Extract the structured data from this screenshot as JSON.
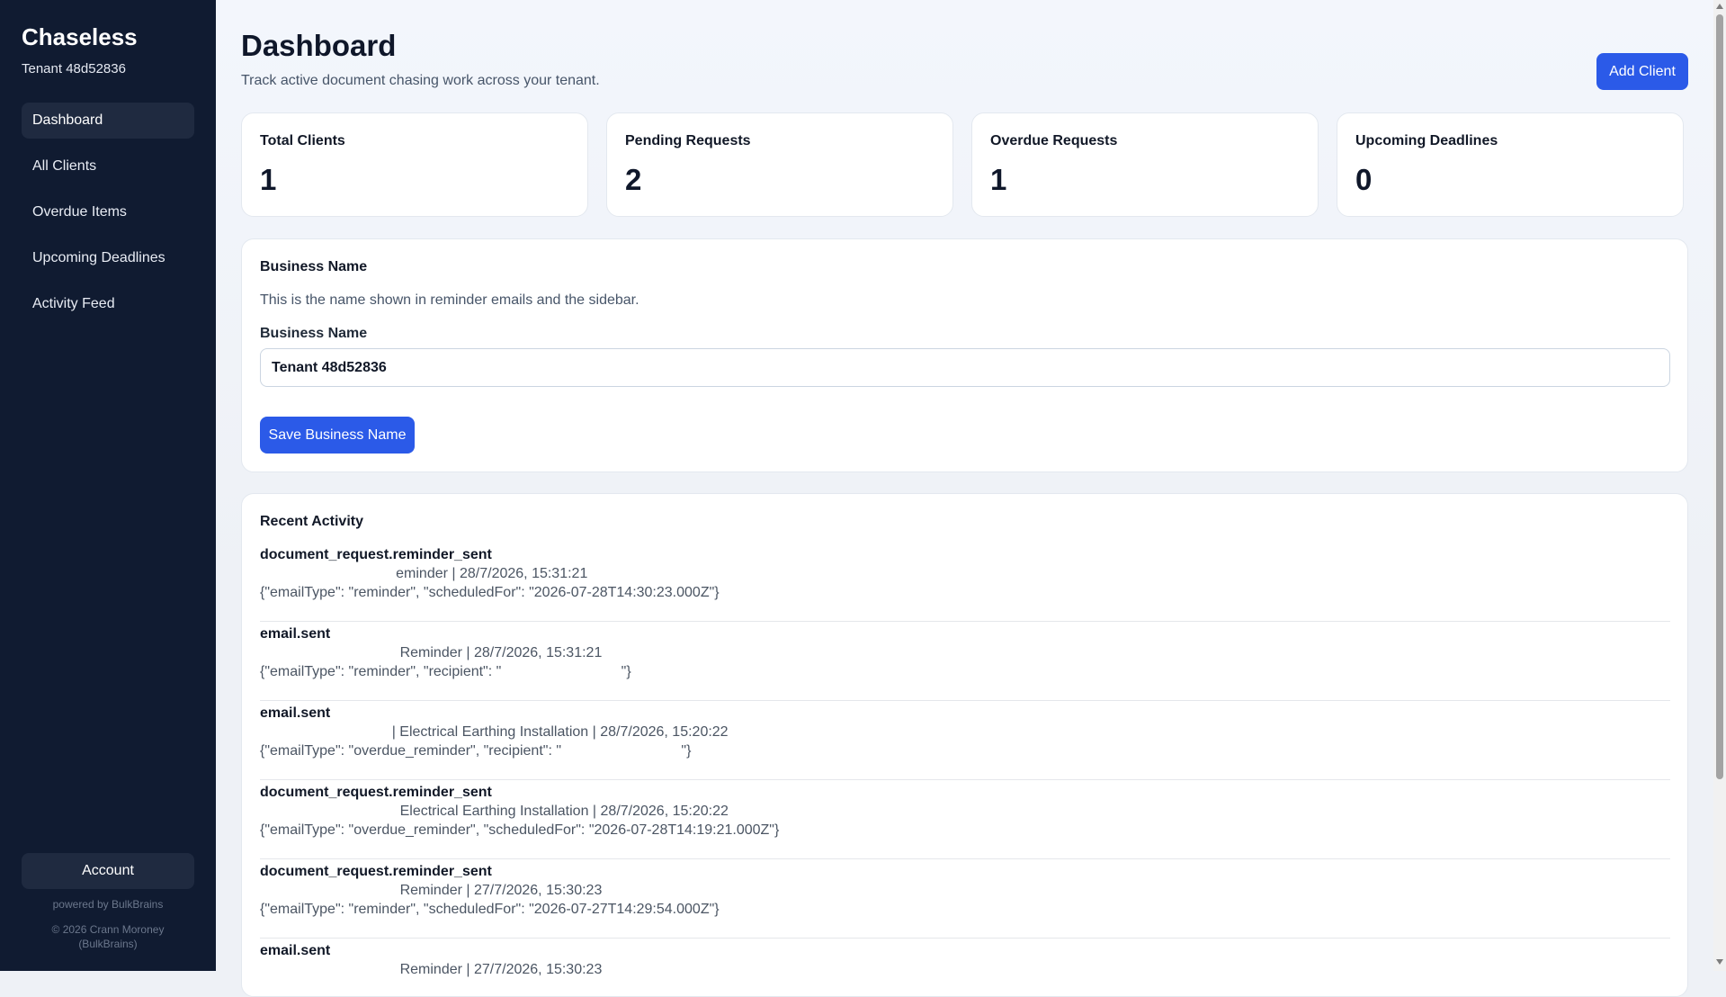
{
  "sidebar": {
    "brand": "Chaseless",
    "tenant": "Tenant 48d52836",
    "nav": [
      {
        "label": "Dashboard"
      },
      {
        "label": "All Clients"
      },
      {
        "label": "Overdue Items"
      },
      {
        "label": "Upcoming Deadlines"
      },
      {
        "label": "Activity Feed"
      }
    ],
    "active_nav": "Dashboard",
    "account_label": "Account",
    "powered_by": "powered by BulkBrains",
    "copyright_line1": "© 2026 Crann Moroney",
    "copyright_line2": "(BulkBrains)"
  },
  "header": {
    "title": "Dashboard",
    "subtitle": "Track active document chasing work across your tenant.",
    "add_client_label": "Add Client"
  },
  "stats": [
    {
      "label": "Total Clients",
      "value": "1"
    },
    {
      "label": "Pending Requests",
      "value": "2"
    },
    {
      "label": "Overdue Requests",
      "value": "1"
    },
    {
      "label": "Upcoming Deadlines",
      "value": "0"
    }
  ],
  "business": {
    "heading": "Business Name",
    "description": "This is the name shown in reminder emails and the sidebar.",
    "field_label": "Business Name",
    "field_value": "Tenant 48d52836",
    "save_label": "Save Business Name"
  },
  "activity": {
    "heading": "Recent Activity",
    "items": [
      {
        "title": "document_request.reminder_sent",
        "meta": "                                  eminder | 28/7/2026, 15:31:21",
        "detail": "{\"emailType\": \"reminder\", \"scheduledFor\": \"2026-07-28T14:30:23.000Z\"}"
      },
      {
        "title": "email.sent",
        "meta": "                                   Reminder | 28/7/2026, 15:31:21",
        "detail": "{\"emailType\": \"reminder\", \"recipient\": \"                              \"}"
      },
      {
        "title": "email.sent",
        "meta": "                                 | Electrical Earthing Installation | 28/7/2026, 15:20:22",
        "detail": "{\"emailType\": \"overdue_reminder\", \"recipient\": \"                              \"}"
      },
      {
        "title": "document_request.reminder_sent",
        "meta": "                                   Electrical Earthing Installation | 28/7/2026, 15:20:22",
        "detail": "{\"emailType\": \"overdue_reminder\", \"scheduledFor\": \"2026-07-28T14:19:21.000Z\"}"
      },
      {
        "title": "document_request.reminder_sent",
        "meta": "                                   Reminder | 27/7/2026, 15:30:23",
        "detail": "{\"emailType\": \"reminder\", \"scheduledFor\": \"2026-07-27T14:29:54.000Z\"}"
      },
      {
        "title": "email.sent",
        "meta": "                                   Reminder | 27/7/2026, 15:30:23",
        "detail": ""
      }
    ]
  }
}
